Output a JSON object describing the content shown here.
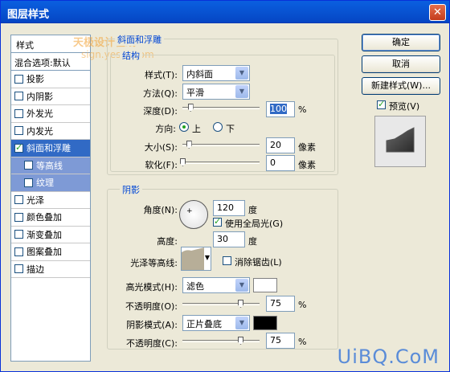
{
  "window": {
    "title": "图层样式",
    "close_glyph": "✕"
  },
  "stylelist": {
    "header": "样式",
    "blend_options": "混合选项:默认",
    "items": [
      {
        "label": "投影",
        "checked": false
      },
      {
        "label": "内阴影",
        "checked": false
      },
      {
        "label": "外发光",
        "checked": false
      },
      {
        "label": "内发光",
        "checked": false
      },
      {
        "label": "斜面和浮雕",
        "checked": true,
        "selected": true
      },
      {
        "label": "等高线",
        "checked": false,
        "sub": true
      },
      {
        "label": "纹理",
        "checked": false,
        "sub": true
      },
      {
        "label": "光泽",
        "checked": false
      },
      {
        "label": "颜色叠加",
        "checked": false
      },
      {
        "label": "渐变叠加",
        "checked": false
      },
      {
        "label": "图案叠加",
        "checked": false
      },
      {
        "label": "描边",
        "checked": false
      }
    ]
  },
  "bevel": {
    "group_title": "斜面和浮雕",
    "structure_title": "结构",
    "style_label": "样式(T):",
    "style_value": "内斜面",
    "technique_label": "方法(Q):",
    "technique_value": "平滑",
    "depth_label": "深度(D):",
    "depth_value": "100",
    "depth_unit": "%",
    "depth_level": 0.1,
    "direction_label": "方向:",
    "direction_up": "上",
    "direction_down": "下",
    "size_label": "大小(S):",
    "size_value": "20",
    "size_unit": "像素",
    "size_level": 0.08,
    "soften_label": "软化(F):",
    "soften_value": "0",
    "soften_unit": "像素",
    "soften_level": 0.0
  },
  "shading": {
    "title": "阴影",
    "angle_label": "角度(N):",
    "angle_value": "120",
    "angle_unit": "度",
    "global_light_label": "使用全局光(G)",
    "global_light_checked": true,
    "altitude_label": "高度:",
    "altitude_value": "30",
    "altitude_unit": "度",
    "gloss_label": "光泽等高线:",
    "antialias_label": "消除锯齿(L)",
    "antialias_checked": false,
    "highlight_mode_label": "高光模式(H):",
    "highlight_mode_value": "滤色",
    "highlight_color": "#ffffff",
    "highlight_opacity_label": "不透明度(O):",
    "highlight_opacity_value": "75",
    "highlight_opacity_unit": "%",
    "highlight_opacity_level": 0.75,
    "shadow_mode_label": "阴影模式(A):",
    "shadow_mode_value": "正片叠底",
    "shadow_color": "#000000",
    "shadow_opacity_label": "不透明度(C):",
    "shadow_opacity_value": "75",
    "shadow_opacity_unit": "%",
    "shadow_opacity_level": 0.75
  },
  "buttons": {
    "ok": "确定",
    "cancel": "取消",
    "new_style": "新建样式(W)...",
    "preview_label": "预览(V)",
    "preview_checked": true
  },
  "watermark": {
    "bottom": "UiBQ.CoM",
    "top_line1": "天极设计在线",
    "top_line2": "sign.yesky.com"
  }
}
